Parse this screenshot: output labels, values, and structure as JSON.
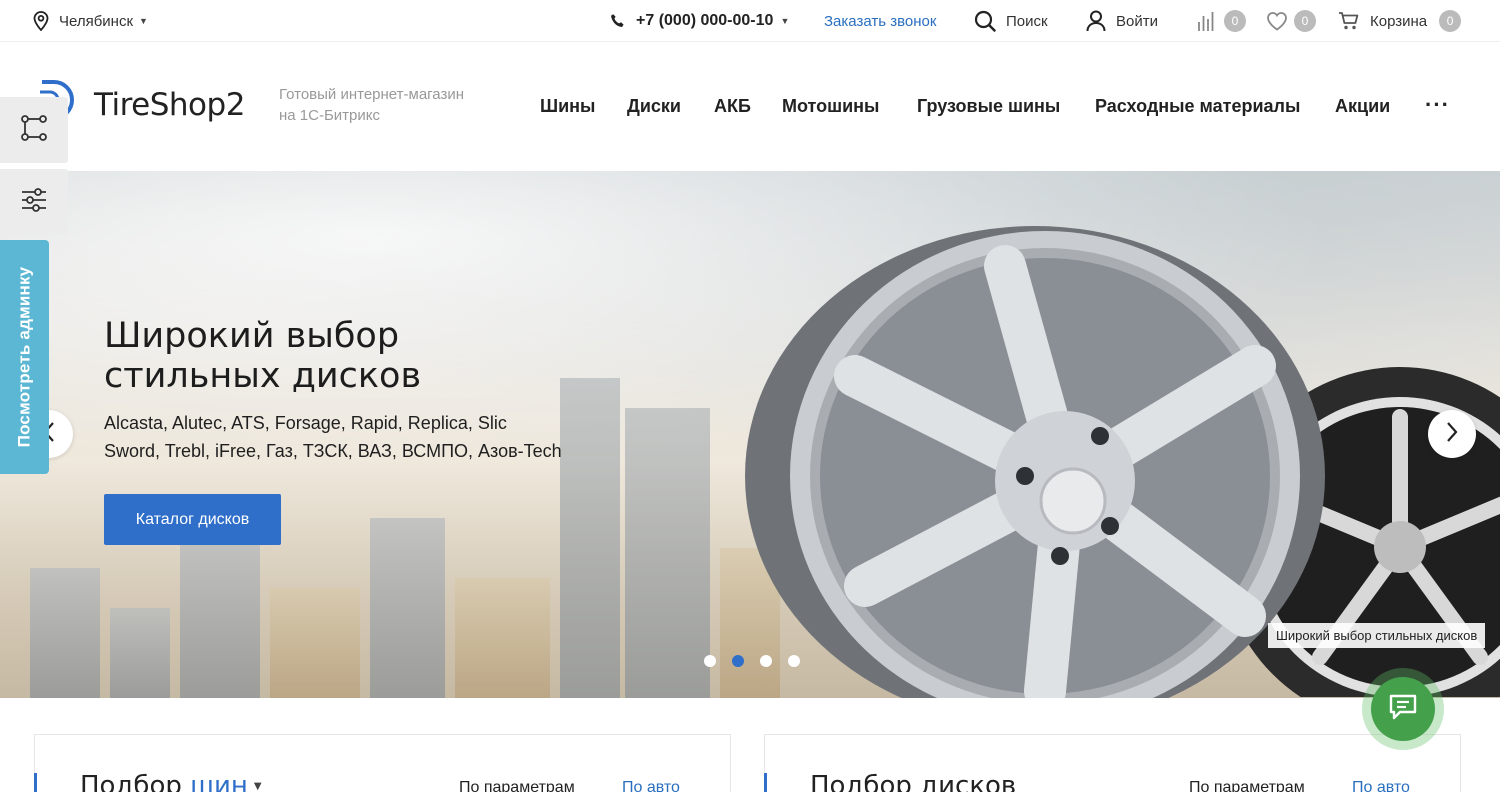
{
  "topbar": {
    "city": "Челябинск",
    "phone": "+7 (000) 000-00-10",
    "callback": "Заказать звонок",
    "search": "Поиск",
    "login": "Войти",
    "compare_count": "0",
    "favorites_count": "0",
    "cart_label": "Корзина",
    "cart_count": "0"
  },
  "header": {
    "logo_text": "TireShop2",
    "tagline": "Готовый интернет-магазин на 1С-Битрикс",
    "nav": [
      "Шины",
      "Диски",
      "АКБ",
      "Мотошины",
      "Грузовые шины",
      "Расходные материалы",
      "Акции"
    ],
    "nav_more": "···"
  },
  "side": {
    "admin_label": "Посмотреть админку"
  },
  "banner": {
    "title_line1": "Широкий выбор",
    "title_line2": "стильных дисков",
    "brands_line1": "Alcasta, Alutec, ATS, Forsage, Rapid, Replica, Slic",
    "brands_line2": "Sword, Trebl, iFree, Газ, ТЗСК, ВАЗ, ВСМПО, Азов-Tech",
    "button": "Каталог дисков",
    "caption": "Широкий выбор стильных дисков",
    "slides_total": 4,
    "active_slide": 2
  },
  "cards": [
    {
      "title_prefix": "Подбор ",
      "title_highlight": "шин",
      "tab_params": "По параметрам",
      "tab_auto": "По авто"
    },
    {
      "title_prefix": "Подбор дисков",
      "title_highlight": "",
      "tab_params": "По параметрам",
      "tab_auto": "По авто"
    }
  ],
  "colors": {
    "accent": "#2f6fc9",
    "admin_tab": "#5bb7d3",
    "chat": "#45a04c",
    "badge": "#bbbbbb"
  },
  "icons": [
    "location-pin-icon",
    "phone-icon",
    "search-icon",
    "user-icon",
    "compare-icon",
    "heart-icon",
    "cart-icon",
    "nodes-icon",
    "sliders-icon",
    "chevron-left-icon",
    "chevron-right-icon",
    "chat-icon"
  ]
}
